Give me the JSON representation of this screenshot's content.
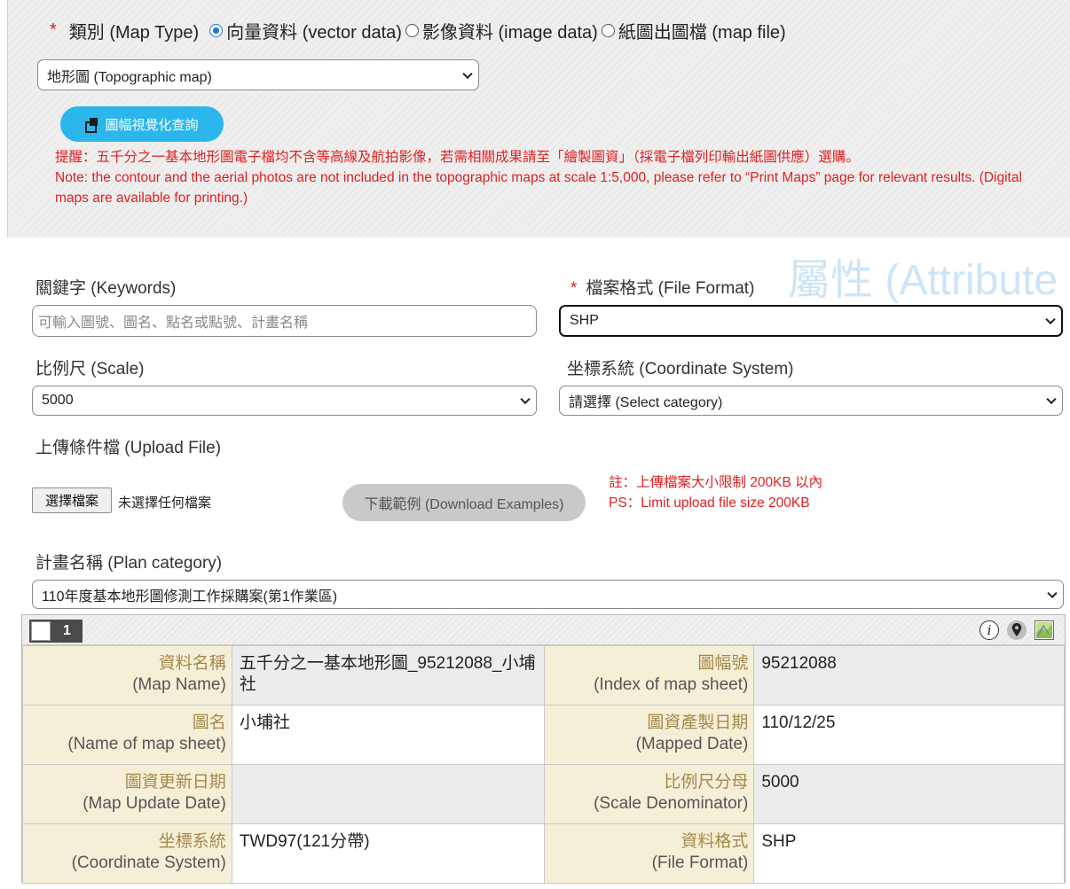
{
  "map_type": {
    "label": "類別 (Map Type)",
    "options": [
      {
        "label": "向量資料 (vector data)",
        "checked": true
      },
      {
        "label": "影像資料 (image data)",
        "checked": false
      },
      {
        "label": "紙圖出圖檔 (map file)",
        "checked": false
      }
    ]
  },
  "map_select": {
    "value": "地形圖 (Topographic map)"
  },
  "vis_button": {
    "label": "圖幅視覺化查詢"
  },
  "notice": {
    "zh": "提醒：五千分之一基本地形圖電子檔均不含等高線及航拍影像，若需相關成果請至「繪製圖資」（採電子檔列印輸出紙圖供應）選購。",
    "en": "Note: the contour and the aerial photos are not included in the topographic maps at scale 1:5,000, please refer to “Print Maps” page for relevant results. (Digital maps are available for printing.)"
  },
  "watermark": "屬性 (Attribute",
  "keywords": {
    "label": "關鍵字 (Keywords)",
    "placeholder": "可輸入圖號、圖名、點名或點號、計畫名稱"
  },
  "file_format": {
    "label": "檔案格式 (File Format)",
    "value": "SHP"
  },
  "scale": {
    "label": "比例尺 (Scale)",
    "value": "5000"
  },
  "coord_system": {
    "label": "坐標系統 (Coordinate System)",
    "value": "請選擇 (Select category)"
  },
  "upload": {
    "label": "上傳條件檔 (Upload File)",
    "choose_button": "選擇檔案",
    "no_file": "未選擇任何檔案",
    "download_button": "下載範例 (Download Examples)",
    "note_zh": "註：上傳檔案大小限制 200KB 以內",
    "note_en": "PS：Limit upload file size 200KB"
  },
  "plan": {
    "label": "計畫名稱 (Plan category)",
    "value": "110年度基本地形圖修測工作採購案(第1作業區)"
  },
  "result": {
    "count": "1",
    "rows": [
      {
        "k1_zh": "資料名稱",
        "k1_en": "(Map Name)",
        "v1": "五千分之一基本地形圖_95212088_小埔社",
        "k2_zh": "圖幅號",
        "k2_en": "(Index of map sheet)",
        "v2": "95212088"
      },
      {
        "k1_zh": "圖名",
        "k1_en": "(Name of map sheet)",
        "v1": "小埔社",
        "k2_zh": "圖資產製日期",
        "k2_en": "(Mapped Date)",
        "v2": "110/12/25"
      },
      {
        "k1_zh": "圖資更新日期",
        "k1_en": "(Map Update Date)",
        "v1": "",
        "k2_zh": "比例尺分母",
        "k2_en": "(Scale Denominator)",
        "v2": "5000"
      },
      {
        "k1_zh": "坐標系統",
        "k1_en": "(Coordinate System)",
        "v1": "TWD97(121分帶)",
        "k2_zh": "資料格式",
        "k2_en": "(File Format)",
        "v2": "SHP"
      }
    ]
  },
  "colors": {
    "accent_blue": "#2bb6ec",
    "warning_red": "#e02020",
    "key_bg": "#f5efd8"
  },
  "icons": [
    "window-restore-icon",
    "info-icon",
    "location-pin-icon",
    "map-thumbnail-icon",
    "chevron-down-icon"
  ]
}
